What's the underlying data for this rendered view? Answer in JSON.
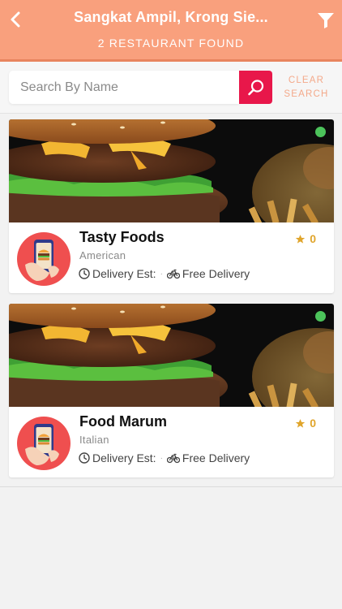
{
  "header": {
    "title": "Sangkat Ampil, Krong Sie...",
    "subtitle": "2 RESTAURANT FOUND"
  },
  "search": {
    "placeholder": "Search By Name",
    "value": "",
    "clear_label_line1": "CLEAR",
    "clear_label_line2": "SEARCH"
  },
  "restaurants": [
    {
      "name": "Tasty Foods",
      "cuisine": "American",
      "delivery_est_label": "Delivery Est:",
      "separator": "·",
      "delivery_type": "Free Delivery",
      "rating": "0",
      "online": true
    },
    {
      "name": "Food Marum",
      "cuisine": "Italian",
      "delivery_est_label": "Delivery Est:",
      "separator": "·",
      "delivery_type": "Free Delivery",
      "rating": "0",
      "online": true
    }
  ],
  "colors": {
    "header": "#f9a07d",
    "search_button": "#e8174a",
    "clear_text": "#f4a98a",
    "online_status": "#4cc35b",
    "rating": "#e0a52c"
  },
  "icons": {
    "back": "chevron-left-icon",
    "filter": "filter-funnel-icon",
    "search": "magnifier-icon",
    "clock": "clock-icon",
    "bike": "bicycle-icon",
    "star": "star-icon"
  }
}
